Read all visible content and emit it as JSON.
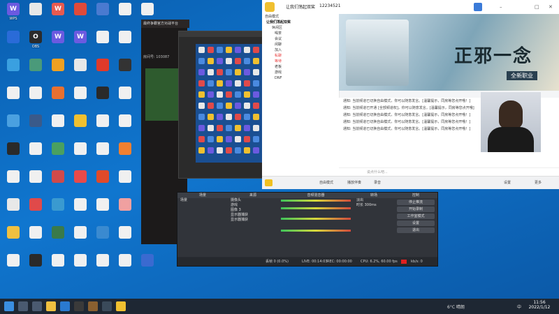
{
  "desktop": {
    "icons": [
      {
        "label": "WPS",
        "color": "#6b5ae0",
        "glyph": "W"
      },
      {
        "label": "",
        "color": "#e8e8e8",
        "glyph": ""
      },
      {
        "label": "",
        "color": "#e85a4f",
        "glyph": "W"
      },
      {
        "label": "",
        "color": "#e04a3a",
        "glyph": ""
      },
      {
        "label": "",
        "color": "#4a7ad0",
        "glyph": ""
      },
      {
        "label": "",
        "color": "#f0f0f0",
        "glyph": ""
      },
      {
        "label": "",
        "color": "#f0f0f0",
        "glyph": ""
      },
      {
        "label": "",
        "color": "#2a6bd8",
        "glyph": ""
      },
      {
        "label": "OBS",
        "color": "#2b2b2b",
        "glyph": "O"
      },
      {
        "label": "",
        "color": "#6b5ae0",
        "glyph": "W"
      },
      {
        "label": "",
        "color": "#6b5ae0",
        "glyph": "W"
      },
      {
        "label": "",
        "color": "#f0f0f0",
        "glyph": ""
      },
      {
        "label": "",
        "color": "#f0f0f0",
        "glyph": ""
      },
      {
        "label": "",
        "color": "#f0f0f0",
        "glyph": ""
      },
      {
        "label": "",
        "color": "#3aa0e0",
        "glyph": ""
      },
      {
        "label": "",
        "color": "#4a9a7a",
        "glyph": ""
      },
      {
        "label": "",
        "color": "#f0a020",
        "glyph": ""
      },
      {
        "label": "",
        "color": "#e8e8e8",
        "glyph": ""
      },
      {
        "label": "",
        "color": "#e03a2a",
        "glyph": ""
      },
      {
        "label": "",
        "color": "#333333",
        "glyph": ""
      },
      {
        "label": "",
        "color": "#f0f0f0",
        "glyph": ""
      },
      {
        "label": "",
        "color": "#f0f0f0",
        "glyph": ""
      },
      {
        "label": "",
        "color": "#f0f0f0",
        "glyph": ""
      },
      {
        "label": "",
        "color": "#e87030",
        "glyph": ""
      },
      {
        "label": "",
        "color": "#f0f0f0",
        "glyph": ""
      },
      {
        "label": "",
        "color": "#2a2a2a",
        "glyph": ""
      },
      {
        "label": "",
        "color": "#f0f0f0",
        "glyph": ""
      },
      {
        "label": "",
        "color": "#f0f0f0",
        "glyph": ""
      },
      {
        "label": "",
        "color": "#4aa0e0",
        "glyph": ""
      },
      {
        "label": "",
        "color": "#3a5a8a",
        "glyph": ""
      },
      {
        "label": "",
        "color": "#f0f0f0",
        "glyph": ""
      },
      {
        "label": "",
        "color": "#f0c030",
        "glyph": ""
      },
      {
        "label": "",
        "color": "#f0f0f0",
        "glyph": ""
      },
      {
        "label": "",
        "color": "#f0f0f0",
        "glyph": ""
      },
      {
        "label": "",
        "color": "#202020",
        "glyph": ""
      },
      {
        "label": "",
        "color": "#2a2a2a",
        "glyph": ""
      },
      {
        "label": "",
        "color": "#f0f0f0",
        "glyph": ""
      },
      {
        "label": "",
        "color": "#4aa060",
        "glyph": ""
      },
      {
        "label": "",
        "color": "#f0f0f0",
        "glyph": ""
      },
      {
        "label": "",
        "color": "#f0f0f0",
        "glyph": ""
      },
      {
        "label": "",
        "color": "#f08030",
        "glyph": ""
      },
      {
        "label": "",
        "color": "#3a3a3a",
        "glyph": ""
      },
      {
        "label": "",
        "color": "#f0f0f0",
        "glyph": ""
      },
      {
        "label": "",
        "color": "#f0f0f0",
        "glyph": ""
      },
      {
        "label": "",
        "color": "#d04a4a",
        "glyph": ""
      },
      {
        "label": "",
        "color": "#e84a4a",
        "glyph": ""
      },
      {
        "label": "",
        "color": "#e04a2a",
        "glyph": ""
      },
      {
        "label": "",
        "color": "#f0f0f0",
        "glyph": ""
      },
      {
        "label": "",
        "color": "#f0f0f0",
        "glyph": ""
      },
      {
        "label": "",
        "color": "#e8e8e8",
        "glyph": ""
      },
      {
        "label": "",
        "color": "#e04a4a",
        "glyph": ""
      },
      {
        "label": "",
        "color": "#3a9ad0",
        "glyph": ""
      },
      {
        "label": "",
        "color": "#f0f0f0",
        "glyph": ""
      },
      {
        "label": "",
        "color": "#f0f0f0",
        "glyph": ""
      },
      {
        "label": "",
        "color": "#f0a0a0",
        "glyph": ""
      },
      {
        "label": "",
        "color": "#f0f0f0",
        "glyph": ""
      },
      {
        "label": "",
        "color": "#f0c040",
        "glyph": ""
      },
      {
        "label": "",
        "color": "#f0f0f0",
        "glyph": ""
      },
      {
        "label": "",
        "color": "#3a7a4a",
        "glyph": ""
      },
      {
        "label": "",
        "color": "#f0f0f0",
        "glyph": ""
      },
      {
        "label": "",
        "color": "#3a8ad0",
        "glyph": ""
      },
      {
        "label": "",
        "color": "#f0f0f0",
        "glyph": ""
      },
      {
        "label": "",
        "color": "#e04a90",
        "glyph": ""
      },
      {
        "label": "",
        "color": "#f0f0f0",
        "glyph": ""
      },
      {
        "label": "",
        "color": "#2a2a2a",
        "glyph": ""
      },
      {
        "label": "",
        "color": "#f0f0f0",
        "glyph": ""
      },
      {
        "label": "",
        "color": "#f0f0f0",
        "glyph": ""
      },
      {
        "label": "",
        "color": "#f0f0f0",
        "glyph": ""
      },
      {
        "label": "",
        "color": "#f0f0f0",
        "glyph": ""
      },
      {
        "label": "",
        "color": "#3a6ad0",
        "glyph": ""
      },
      {
        "label": "",
        "color": "#a07030",
        "glyph": ""
      }
    ]
  },
  "game_window": {
    "title": "最终争霸官方对战平台",
    "room_label": "房间号: 103087"
  },
  "obs": {
    "scenes_header": "场景",
    "sources_header": "来源",
    "mixer_header": "音频混音器",
    "transition_header": "转场",
    "controls_header": "控制",
    "scenes": [
      "场景"
    ],
    "sources": [
      "摄像头",
      "游戏",
      "图像 3",
      "显示器捕获",
      "显示器捕获"
    ],
    "transition_value": "淡出",
    "duration_label": "时长",
    "duration_value": "300ms",
    "controls": [
      "停止推流",
      "开始录制",
      "工作室模式",
      "设置",
      "退出"
    ],
    "status": {
      "dropped": "丢帧 0 (0.0%)",
      "live": "LIVE: 00:14:03",
      "rec": "REC: 00:00:00",
      "cpu": "CPU: 6.2%, 60.00 fps",
      "kbps": "kb/s: 0"
    }
  },
  "yy": {
    "title": "让我们荡起双桨",
    "id": "12234521",
    "mode": "自由模式",
    "tree": {
      "root": "让我们荡起双桨",
      "items": [
        "休闲区",
        "喝茶",
        "会议",
        "闲聊",
        "加入",
        "私聊",
        "等待",
        "老板",
        "游戏",
        "DNF"
      ]
    },
    "banner_text": "正邪一念",
    "banner_sub": "全新职业",
    "chat_lines": [
      "通知: 当前频道已切换自由模式，你可以随意发言。[温馨提示，同房等您点开哦！]",
      "通知: 当前频道已开通 [全部频道权]，你可以随意发言。[温馨提示，同房等您点开哦]",
      "通知: 当前频道已切换自由模式，你可以随意发言。[温馨提示，同房等您点开哦！]",
      "通知: 当前频道已切换自由模式，你可以随意发言。[温馨提示，同房等您点开哦！]",
      "通知: 当前频道已切换自由模式，你可以随意发言。[温馨提示，同房等您点开哦！]"
    ],
    "input_placeholder": "说点什么吧...",
    "bottom": {
      "free_mode": "自由模式",
      "broadcast": "播放伴奏",
      "record": "录音",
      "settings": "设置",
      "more": "更多"
    }
  },
  "taskbar": {
    "weather": "6°C 晴朗",
    "time": "11:56",
    "date": "2022/1/12",
    "lang": "中"
  },
  "colors": {
    "desktop": "#0e6bc0",
    "obs_bg": "#2a2d33",
    "yy_bg": "#f4f5f7",
    "taskbar": "#1e2733",
    "accent": "#e84040"
  }
}
